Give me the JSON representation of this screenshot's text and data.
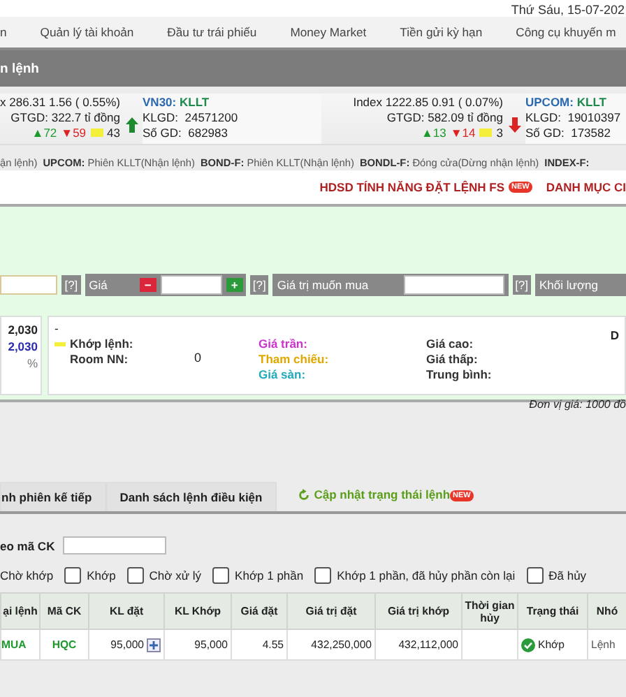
{
  "date": "Thứ Sáu, 15-07-202",
  "nav": [
    "n",
    "Quản lý tài khoản",
    "Đầu tư trái phiếu",
    "Money Market",
    "Tiền gửi kỳ hạn",
    "Công cụ khuyến m"
  ],
  "page_title": "n lệnh",
  "indices": [
    {
      "label": "x",
      "value": "286.31",
      "change": "1.56 ( 0.55%)",
      "gtgd_label": "GTGD:",
      "gtgd": "322.7 tỉ đồng",
      "up": "▲72",
      "down": "▼59",
      "flat": "43",
      "rising": true,
      "board": {
        "name": "VN30:",
        "status": "KLLT",
        "klgd_label": "KLGD:",
        "klgd": "24571200",
        "sogd_label": "Số GD:",
        "sogd": "682983"
      }
    },
    {
      "label": "Index",
      "value": "1222.85",
      "change": "0.91 ( 0.07%)",
      "gtgd_label": "GTGD:",
      "gtgd": "582.09 tỉ đồng",
      "up": "▲13",
      "down": "▼14",
      "flat": "3",
      "rising": false,
      "board": {
        "name": "UPCOM:",
        "status": "KLLT",
        "klgd_label": "KLGD:",
        "klgd": "19010397",
        "sogd_label": "Số GD:",
        "sogd": "173582"
      }
    }
  ],
  "sessions": [
    {
      "status": "ận lệnh)"
    },
    {
      "market": "UPCOM:",
      "status": "Phiên KLLT(Nhận lệnh)"
    },
    {
      "market": "BOND-F:",
      "status": "Phiên KLLT(Nhận lệnh)"
    },
    {
      "market": "BONDL-F:",
      "status": "Đóng cửa(Dừng nhận lệnh)"
    },
    {
      "market": "INDEX-F:"
    }
  ],
  "links": [
    {
      "label": "HDSD TÍNH NĂNG ĐẶT LỆNH FS",
      "badge": "NEW"
    },
    {
      "label": "DANH MỤC CI"
    }
  ],
  "order_fields": [
    {
      "kind": "input",
      "help": "[?]"
    },
    {
      "kind": "price",
      "label": "Giá",
      "minus": "−",
      "plus": "+",
      "help": "[?]"
    },
    {
      "kind": "labeled",
      "label": "Giá trị muốn mua",
      "help": "[?]"
    },
    {
      "kind": "label",
      "label": "Khối lượng"
    }
  ],
  "summary": [
    "2,030",
    "2,030",
    "%"
  ],
  "quote": {
    "dash": "-",
    "match_label": "Khớp lệnh:",
    "room_label": "Room NN:",
    "room_value": "0",
    "prices": [
      {
        "label": "Giá trần:",
        "color": "#cc33cc"
      },
      {
        "label": "Tham chiếu:",
        "color": "#e0a800"
      },
      {
        "label": "Giá sàn:",
        "color": "#22aabb"
      }
    ],
    "stats": [
      "Giá cao:",
      "Giá thấp:",
      "Trung bình:"
    ],
    "edge": "D"
  },
  "unit_note": "Đơn vị giá: 1000 đồ",
  "tabs": [
    "nh phiên kế tiếp",
    "Danh sách lệnh điều kiện"
  ],
  "refresh": {
    "label": "Cập nhật trạng thái lệnh",
    "badge": "NEW"
  },
  "filter": {
    "label": "eo mã CK"
  },
  "status_lead": "Chờ khớp",
  "status_filters": [
    {
      "label": "Khớp",
      "checked": false
    },
    {
      "label": "Chờ xử lý",
      "checked": false
    },
    {
      "label": "Khớp 1 phần",
      "checked": false
    },
    {
      "label": "Khớp 1 phần, đã hủy phần còn lại",
      "checked": false
    },
    {
      "label": "Đã hủy",
      "checked": false
    }
  ],
  "table": {
    "columns": [
      "ại lệnh",
      "Mã CK",
      "KL đặt",
      "KL Khớp",
      "Giá đặt",
      "Giá trị đặt",
      "Giá trị khớp",
      "Thời gian hủy",
      "Trạng thái",
      "Nhó"
    ],
    "rows": [
      {
        "side": "MUA",
        "symbol": "HQC",
        "qty": "95,000",
        "expandable": true,
        "matched_qty": "95,000",
        "price": "4.55",
        "value": "432,250,000",
        "matched_value": "432,112,000",
        "status": "Khớp",
        "status_ok": true,
        "group": "Lệnh"
      }
    ]
  }
}
